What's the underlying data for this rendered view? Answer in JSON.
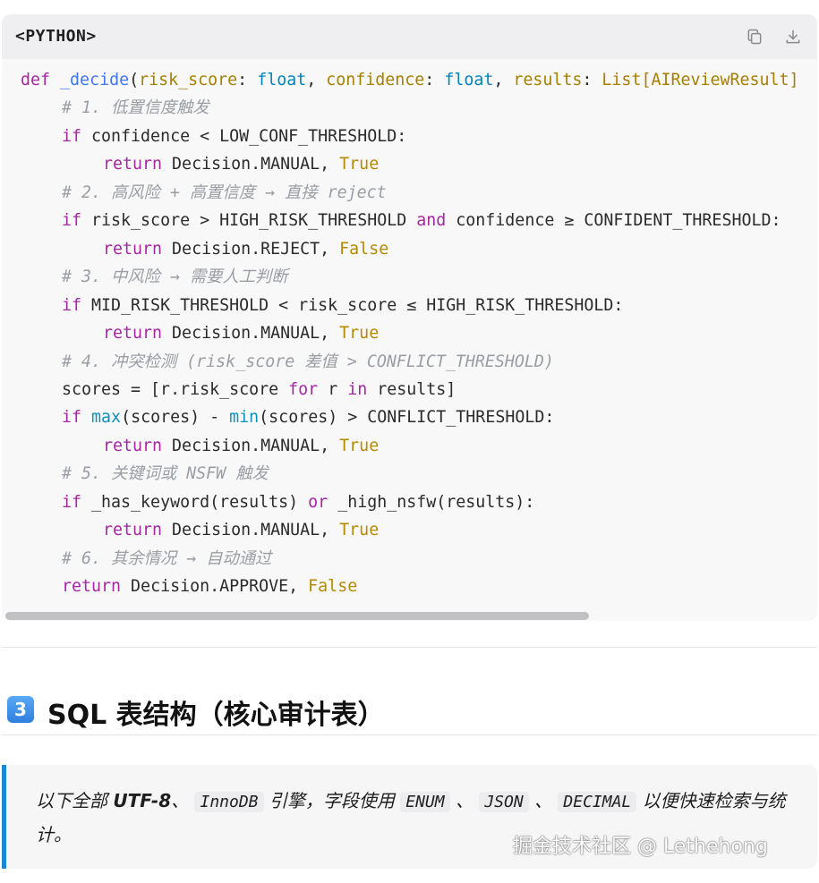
{
  "code_block": {
    "language_label": "<PYTHON>",
    "lines": [
      {
        "indent": 0,
        "tokens": [
          [
            "kw",
            "def"
          ],
          [
            "",
            " "
          ],
          [
            "fn",
            "_decide"
          ],
          [
            "",
            "("
          ],
          [
            "pa",
            "risk_score"
          ],
          [
            "",
            ": "
          ],
          [
            "ty",
            "float"
          ],
          [
            "",
            ", "
          ],
          [
            "pa",
            "confidence"
          ],
          [
            "",
            ": "
          ],
          [
            "ty",
            "float"
          ],
          [
            "",
            ", "
          ],
          [
            "pa",
            "results"
          ],
          [
            "",
            ": "
          ],
          [
            "pa",
            "List[AIReviewResult]"
          ]
        ]
      },
      {
        "indent": 1,
        "tokens": [
          [
            "cm",
            "# 1. 低置信度触发"
          ]
        ]
      },
      {
        "indent": 1,
        "tokens": [
          [
            "kw",
            "if"
          ],
          [
            "",
            " confidence < LOW_CONF_THRESHOLD:"
          ]
        ]
      },
      {
        "indent": 2,
        "tokens": [
          [
            "kw",
            "return"
          ],
          [
            "",
            " Decision.MANUAL, "
          ],
          [
            "bo",
            "True"
          ]
        ]
      },
      {
        "indent": 1,
        "tokens": [
          [
            "cm",
            "# 2. 高风险 + 高置信度 → 直接 reject"
          ]
        ]
      },
      {
        "indent": 1,
        "tokens": [
          [
            "kw",
            "if"
          ],
          [
            "",
            " risk_score > HIGH_RISK_THRESHOLD "
          ],
          [
            "kw",
            "and"
          ],
          [
            "",
            " confidence ≥ CONFIDENT_THRESHOLD:"
          ]
        ]
      },
      {
        "indent": 2,
        "tokens": [
          [
            "kw",
            "return"
          ],
          [
            "",
            " Decision.REJECT, "
          ],
          [
            "bo",
            "False"
          ]
        ]
      },
      {
        "indent": 1,
        "tokens": [
          [
            "cm",
            "# 3. 中风险 → 需要人工判断"
          ]
        ]
      },
      {
        "indent": 1,
        "tokens": [
          [
            "kw",
            "if"
          ],
          [
            "",
            " MID_RISK_THRESHOLD < risk_score ≤ HIGH_RISK_THRESHOLD:"
          ]
        ]
      },
      {
        "indent": 2,
        "tokens": [
          [
            "kw",
            "return"
          ],
          [
            "",
            " Decision.MANUAL, "
          ],
          [
            "bo",
            "True"
          ]
        ]
      },
      {
        "indent": 1,
        "tokens": [
          [
            "cm",
            "# 4. 冲突检测 (risk_score 差值 > CONFLICT_THRESHOLD)"
          ]
        ]
      },
      {
        "indent": 1,
        "tokens": [
          [
            "",
            "scores = [r.risk_score "
          ],
          [
            "kw",
            "for"
          ],
          [
            "",
            " r "
          ],
          [
            "kw",
            "in"
          ],
          [
            "",
            " results]"
          ]
        ]
      },
      {
        "indent": 1,
        "tokens": [
          [
            "kw",
            "if"
          ],
          [
            "",
            " "
          ],
          [
            "bi",
            "max"
          ],
          [
            "",
            "(scores) - "
          ],
          [
            "bi",
            "min"
          ],
          [
            "",
            "(scores) > CONFLICT_THRESHOLD:"
          ]
        ]
      },
      {
        "indent": 2,
        "tokens": [
          [
            "kw",
            "return"
          ],
          [
            "",
            " Decision.MANUAL, "
          ],
          [
            "bo",
            "True"
          ]
        ]
      },
      {
        "indent": 1,
        "tokens": [
          [
            "cm",
            "# 5. 关键词或 NSFW 触发"
          ]
        ]
      },
      {
        "indent": 1,
        "tokens": [
          [
            "kw",
            "if"
          ],
          [
            "",
            " _has_keyword(results) "
          ],
          [
            "kw",
            "or"
          ],
          [
            "",
            " _high_nsfw(results):"
          ]
        ]
      },
      {
        "indent": 2,
        "tokens": [
          [
            "kw",
            "return"
          ],
          [
            "",
            " Decision.MANUAL, "
          ],
          [
            "bo",
            "True"
          ]
        ]
      },
      {
        "indent": 1,
        "tokens": [
          [
            "cm",
            "# 6. 其余情况 → 自动通过"
          ]
        ]
      },
      {
        "indent": 1,
        "tokens": [
          [
            "kw",
            "return"
          ],
          [
            "",
            " Decision.APPROVE, "
          ],
          [
            "bo",
            "False"
          ]
        ]
      }
    ]
  },
  "icons": {
    "copy": "copy-icon",
    "download": "download-icon"
  },
  "section": {
    "badge": "3",
    "title": "SQL 表结构（核心审计表）"
  },
  "note": {
    "prefix": "以下全部 ",
    "bold": "UTF-8",
    "sep1": "、 ",
    "code1": "InnoDB",
    "mid": " 引擎，字段使用 ",
    "code2": "ENUM",
    "sep2": " 、 ",
    "code3": "JSON",
    "sep3": " 、 ",
    "code4": "DECIMAL",
    "suffix": " 以便快速检索与统计。"
  },
  "watermark": "掘金技术社区 @ Lethehong",
  "colors": {
    "keyword": "#a626a4",
    "function": "#4078f2",
    "type": "#0184bc",
    "param": "#a67f00",
    "comment": "#9a9ea4",
    "accent_bar": "#1a86d8"
  }
}
